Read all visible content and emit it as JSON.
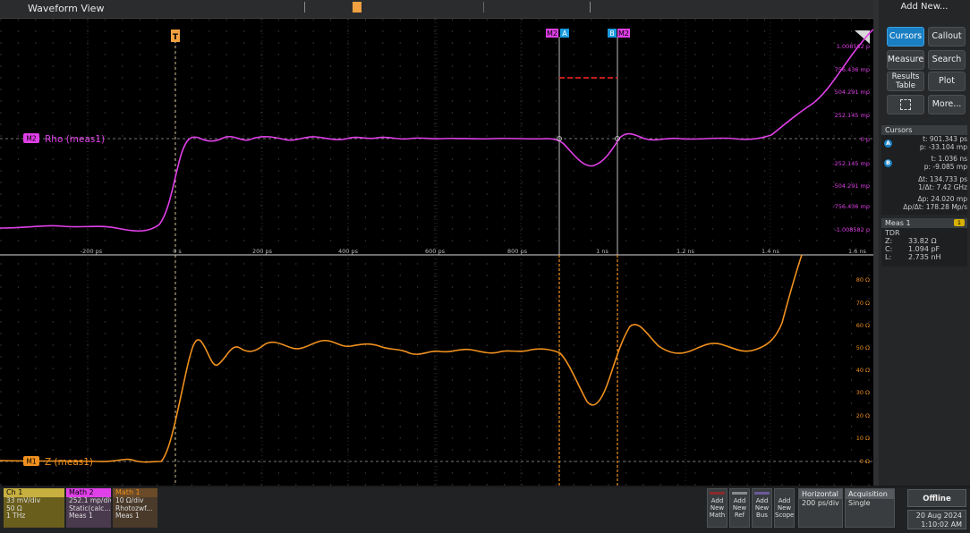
{
  "waveform_view": {
    "title": "Waveform View",
    "trigger_marker": "T",
    "cursor_labels": [
      "M2",
      "A",
      "B",
      "M2"
    ]
  },
  "upper_plot": {
    "trace_label": "Rho (meas1)",
    "trace_badge": "M2",
    "y_ticks": [
      "1.008582 p",
      "756.436 mp",
      "504.291 mp",
      "252.145 mp",
      "0 p",
      "-252.145 mp",
      "-504.291 mp",
      "-756.436 mp",
      "-1.008582 p"
    ],
    "x_ticks": [
      "-200 ps",
      "0 s",
      "200 ps",
      "400 ps",
      "600 ps",
      "800 ps",
      "1 ns",
      "1.2 ns",
      "1.4 ns",
      "1.6 ns"
    ],
    "trace_color": "#e040e8"
  },
  "lower_plot": {
    "trace_label": "Z (meas1)",
    "trace_badge": "M1",
    "y_ticks": [
      "80 Ω",
      "70 Ω",
      "60 Ω",
      "50 Ω",
      "40 Ω",
      "30 Ω",
      "20 Ω",
      "10 Ω",
      "0 Ω"
    ],
    "trace_color": "#f0901e"
  },
  "right_panel": {
    "header": "Add New...",
    "buttons": {
      "cursors": "Cursors",
      "callout": "Callout",
      "measure": "Measure",
      "search": "Search",
      "results_table": "Results Table",
      "plot": "Plot",
      "more": "More..."
    },
    "cursors": {
      "title": "Cursors",
      "a_badge": "A",
      "a_time": "t: 901.343 ps",
      "a_value": "p: -33.104 mp",
      "b_badge": "B",
      "b_time": "t: 1.036 ns",
      "b_value": "p: -9.085 mp",
      "delta_t": "Δt: 134.733 ps",
      "inv_delta_t": "1/Δt: 7.42 GHz",
      "delta_p": "Δp: 24.020 mp",
      "slope": "Δp/Δt: 178.28 Mp/s"
    },
    "meas": {
      "title": "Meas 1",
      "badge": "1",
      "type": "TDR",
      "z_label": "Z:",
      "z_value": "33.82 Ω",
      "c_label": "C:",
      "c_value": "1.094 pF",
      "l_label": "L:",
      "l_value": "2.735 nH"
    }
  },
  "bottom_bar": {
    "ch1": {
      "title": "Ch 1",
      "lines": [
        "33 mV/div",
        "50 Ω",
        "1 THz"
      ],
      "color": "#c8b040"
    },
    "math2": {
      "title": "Math 2",
      "lines": [
        "252.1 mp/div",
        "Static(calc...",
        "Meas 1"
      ],
      "color": "#e040e8"
    },
    "math1": {
      "title": "Math 1",
      "lines": [
        "10 Ω/div",
        "Rhotozwf...",
        "Meas 1"
      ],
      "color": "#f0901e"
    },
    "add_math": "Add New Math",
    "add_ref": "Add New Ref",
    "add_bus": "Add New Bus",
    "add_scope": "Add New Scope",
    "horizontal": {
      "title": "Horizontal",
      "value": "200 ps/div"
    },
    "acquisition": {
      "title": "Acquisition",
      "value": "Single"
    },
    "offline": "Offline",
    "date": "20 Aug 2024",
    "time": "1:10:02 AM"
  }
}
